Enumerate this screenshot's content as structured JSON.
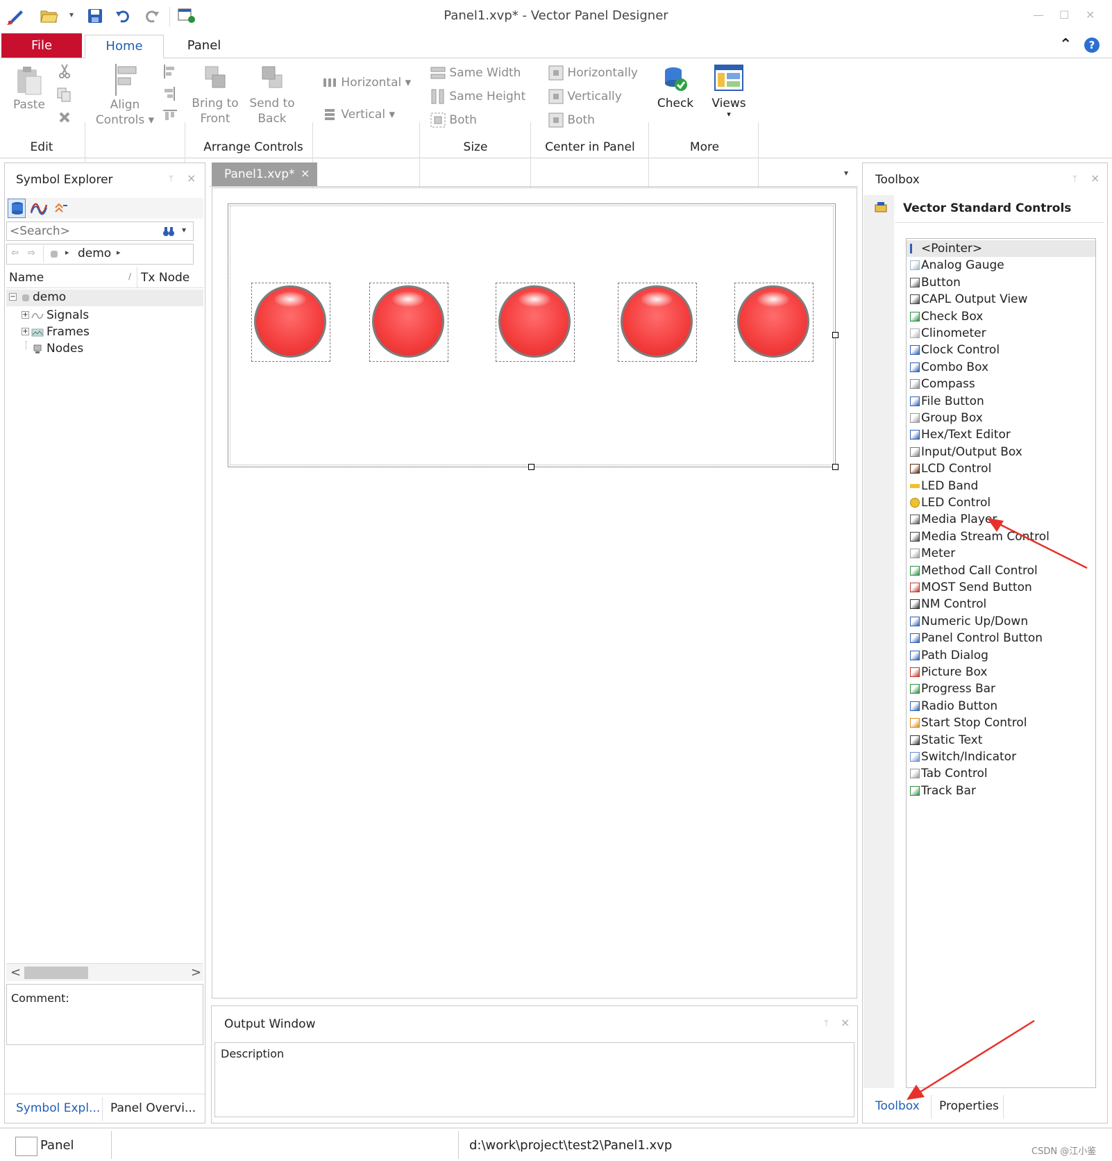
{
  "titlebar": {
    "title": "Panel1.xvp* - Vector Panel Designer",
    "minimize": "—",
    "maximize": "☐",
    "close": "✕",
    "quick_dropdown": "▾"
  },
  "ribbon": {
    "tabs": {
      "file": "File",
      "home": "Home",
      "panel": "Panel"
    },
    "collapse": "⌃",
    "help": "?",
    "edit": {
      "paste": "Paste",
      "label": "Edit"
    },
    "arrange": {
      "align": "Align",
      "controls": "Controls ▾",
      "bring": "Bring to",
      "front": "Front",
      "send": "Send to",
      "back": "Back",
      "horizontal": "Horizontal ▾",
      "vertical": "Vertical ▾",
      "label": "Arrange Controls"
    },
    "size": {
      "same_width": "Same Width",
      "same_height": "Same Height",
      "both": "Both",
      "label": "Size"
    },
    "center": {
      "horizontally": "Horizontally",
      "vertically": "Vertically",
      "both": "Both",
      "label": "Center in Panel"
    },
    "more": {
      "check": "Check",
      "views": "Views",
      "views_arrow": "▾",
      "label": "More"
    }
  },
  "symbol_explorer": {
    "title": "Symbol Explorer",
    "pin": "📌",
    "close": "×",
    "search_placeholder": "<Search>",
    "search_dropdown": "▾",
    "path": "demo",
    "path_arrow": "▸",
    "columns": {
      "name": "Name",
      "tx_node": "Tx Node",
      "sort_mark": "/"
    },
    "tree": {
      "root": "demo",
      "signals": "Signals",
      "frames": "Frames",
      "nodes": "Nodes"
    },
    "scroll_left": "<",
    "scroll_right": ">",
    "comment_label": "Comment:",
    "tabs": {
      "symbol": "Symbol Expl...",
      "overview": "Panel Overvi..."
    }
  },
  "document": {
    "tab_label": "Panel1.xvp*",
    "tab_close": "×",
    "dropdown": "▾"
  },
  "output": {
    "title": "Output Window",
    "pin": "📌",
    "close": "×",
    "column": "Description"
  },
  "toolbox": {
    "title": "Toolbox",
    "pin": "📌",
    "close": "×",
    "group": "Vector Standard Controls",
    "items": [
      "<Pointer>",
      "Analog Gauge",
      "Button",
      "CAPL Output View",
      "Check Box",
      "Clinometer",
      "Clock Control",
      "Combo Box",
      "Compass",
      "File Button",
      "Group Box",
      "Hex/Text Editor",
      "Input/Output Box",
      "LCD Control",
      "LED Band",
      "LED Control",
      "Media Player",
      "Media Stream Control",
      "Meter",
      "Method Call Control",
      "MOST Send Button",
      "NM Control",
      "Numeric Up/Down",
      "Panel Control Button",
      "Path Dialog",
      "Picture Box",
      "Progress Bar",
      "Radio Button",
      "Start Stop Control",
      "Static Text",
      "Switch/Indicator",
      "Tab Control",
      "Track Bar"
    ],
    "tabs": {
      "toolbox": "Toolbox",
      "properties": "Properties"
    }
  },
  "statusbar": {
    "mode": "Panel",
    "path": "d:\\work\\project\\test2\\Panel1.xvp",
    "watermark": "CSDN @江小鉴"
  },
  "colors": {
    "file_tab": "#c8102e",
    "accent_blue": "#1f5fb5",
    "led_red": "#f54040",
    "arrow_red": "#e8302a"
  }
}
